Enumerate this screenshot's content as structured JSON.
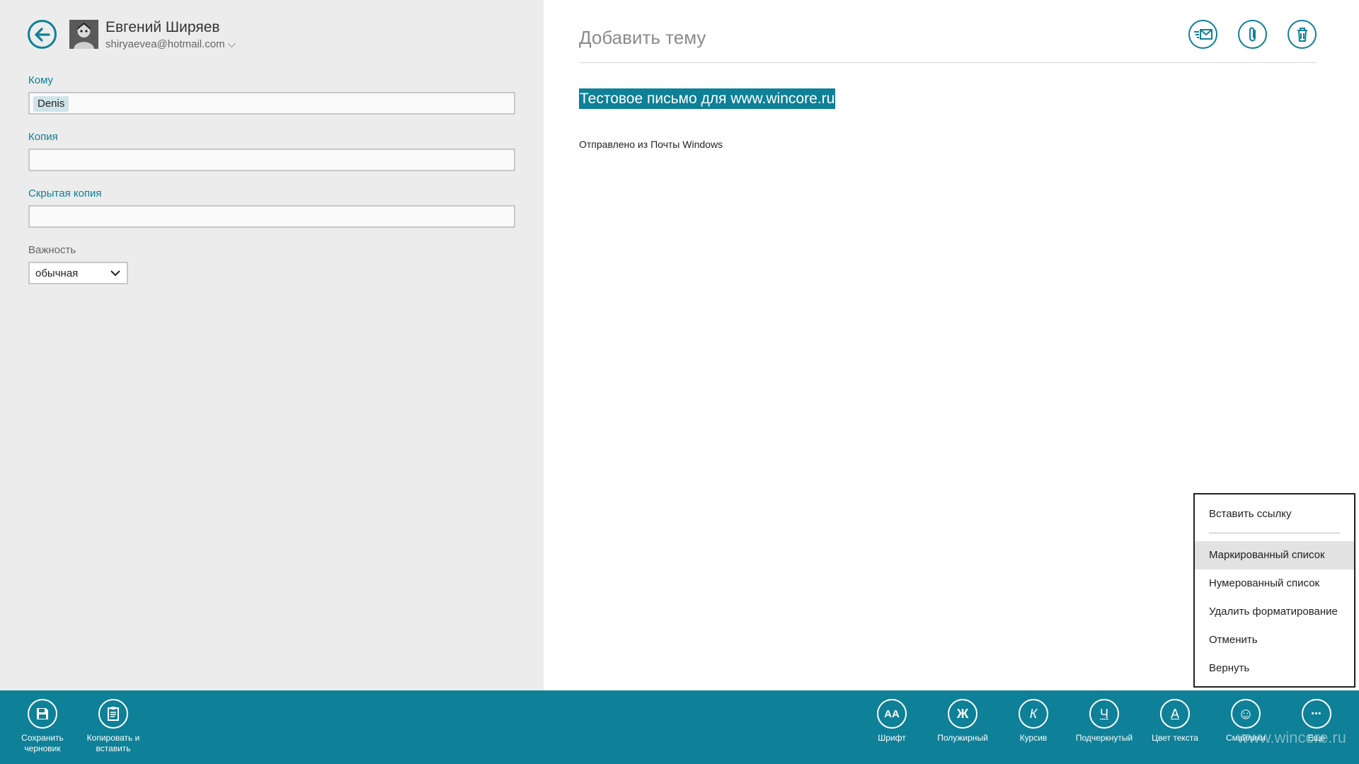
{
  "colors": {
    "accent": "#0e8097",
    "pane": "#ececec",
    "menu_hover": "#e2e2e2"
  },
  "sender": {
    "name": "Евгений Ширяев",
    "email": "shiryaevea@hotmail.com"
  },
  "fields": {
    "to": {
      "label": "Кому",
      "recipient": "Denis"
    },
    "cc": {
      "label": "Копия",
      "value": ""
    },
    "bcc": {
      "label": "Скрытая копия",
      "value": ""
    },
    "importance": {
      "label": "Важность",
      "selected": "обычная"
    }
  },
  "message": {
    "subject_placeholder": "Добавить тему",
    "body_text": "Тестовое письмо для www.wincore.ru",
    "signature": "Отправлено из Почты Windows"
  },
  "top_icons": [
    "send-icon",
    "attach-icon",
    "delete-icon"
  ],
  "context_menu": {
    "items": [
      {
        "label": "Вставить ссылку"
      },
      {
        "label": "Маркированный список"
      },
      {
        "label": "Нумерованный список"
      },
      {
        "label": "Удалить форматирование"
      },
      {
        "label": "Отменить"
      },
      {
        "label": "Вернуть"
      }
    ]
  },
  "appbar": {
    "save": {
      "label": "Сохранить\nчерновик",
      "icon": "save-icon"
    },
    "paste": {
      "label": "Копировать и\nвставить",
      "icon": "clipboard-icon"
    },
    "font": {
      "label": "Шрифт",
      "glyph": "AA"
    },
    "bold": {
      "label": "Полужирный",
      "glyph": "Ж"
    },
    "italic": {
      "label": "Курсив",
      "glyph": "К"
    },
    "underline": {
      "label": "Подчеркнутый",
      "glyph": "Ч"
    },
    "color": {
      "label": "Цвет текста",
      "glyph": "A"
    },
    "emoji": {
      "label": "Смайлики",
      "glyph": "☺"
    },
    "more": {
      "label": "Еще",
      "glyph": "•••"
    }
  },
  "watermark": "www.wincore.ru"
}
